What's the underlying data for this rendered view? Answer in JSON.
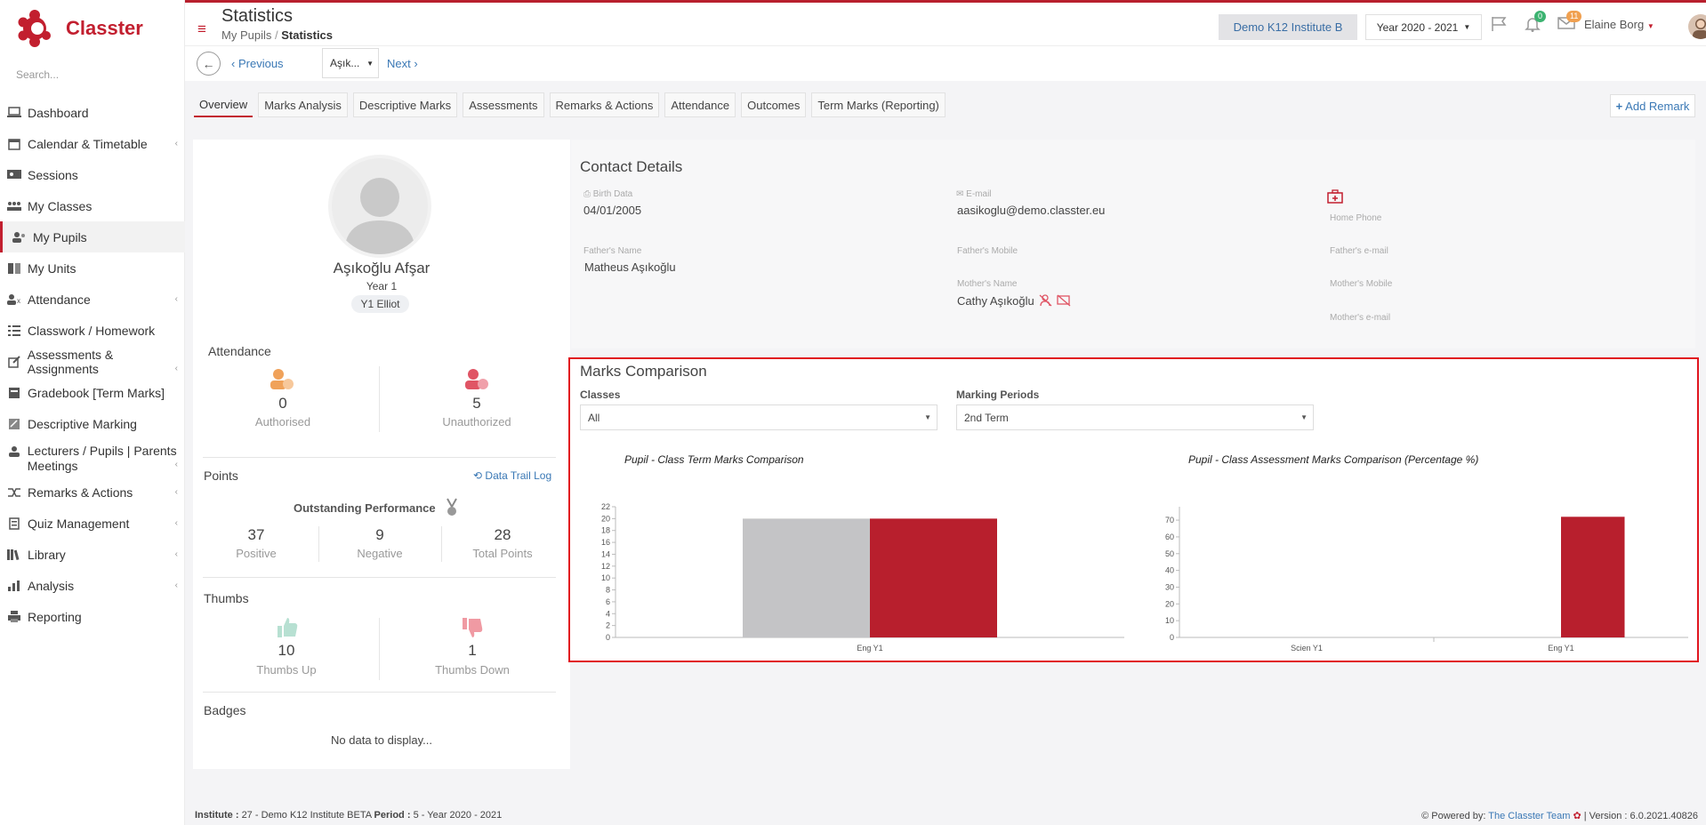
{
  "app": {
    "name": "Classter"
  },
  "sidebar": {
    "search_placeholder": "Search...",
    "items": [
      {
        "label": "Dashboard"
      },
      {
        "label": "Calendar & Timetable"
      },
      {
        "label": "Sessions"
      },
      {
        "label": "My Classes"
      },
      {
        "label": "My Pupils"
      },
      {
        "label": "My Units"
      },
      {
        "label": "Attendance"
      },
      {
        "label": "Classwork / Homework"
      },
      {
        "label": "Assessments & Assignments"
      },
      {
        "label": "Gradebook [Term Marks]"
      },
      {
        "label": "Descriptive Marking"
      },
      {
        "label": "Lecturers / Pupils | Parents Meetings"
      },
      {
        "label": "Remarks & Actions"
      },
      {
        "label": "Quiz Management"
      },
      {
        "label": "Library"
      },
      {
        "label": "Analysis"
      },
      {
        "label": "Reporting"
      }
    ]
  },
  "header": {
    "title": "Statistics",
    "breadcrumb": [
      "My Pupils",
      "Statistics"
    ],
    "institute": "Demo K12 Institute B",
    "year": "Year 2020 - 2021",
    "notifications_count": "0",
    "messages_count": "11",
    "user": "Elaine Borg"
  },
  "subbar": {
    "previous": "Previous",
    "pupil_short": "Aşık...",
    "next": "Next"
  },
  "tabs": [
    "Overview",
    "Marks Analysis",
    "Descriptive Marks",
    "Assessments",
    "Remarks & Actions",
    "Attendance",
    "Outcomes",
    "Term Marks (Reporting)"
  ],
  "add_remark": "Add Remark",
  "pupil": {
    "name": "Aşıkoğlu Afşar",
    "year": "Year 1",
    "class": "Y1 Elliot"
  },
  "attendance": {
    "title": "Attendance",
    "authorised": "0",
    "authorised_label": "Authorised",
    "unauthorized": "5",
    "unauthorized_label": "Unauthorized"
  },
  "points": {
    "title": "Points",
    "data_trail": "Data Trail Log",
    "performance": "Outstanding Performance",
    "positive": "37",
    "positive_label": "Positive",
    "negative": "9",
    "negative_label": "Negative",
    "total": "28",
    "total_label": "Total Points"
  },
  "thumbs": {
    "title": "Thumbs",
    "up": "10",
    "up_label": "Thumbs Up",
    "down": "1",
    "down_label": "Thumbs Down"
  },
  "badges": {
    "title": "Badges",
    "empty": "No data to display..."
  },
  "contact": {
    "title": "Contact Details",
    "birth_label": "Birth Data",
    "birth_value": "04/01/2005",
    "email_label": "E-mail",
    "email_value": "aasikoglu@demo.classter.eu",
    "home_phone_label": "Home Phone",
    "father_name_label": "Father's Name",
    "father_name_value": "Matheus Aşıkoğlu",
    "father_mobile_label": "Father's Mobile",
    "father_email_label": "Father's e-mail",
    "mother_name_label": "Mother's Name",
    "mother_name_value": "Cathy Aşıkoğlu",
    "mother_mobile_label": "Mother's Mobile",
    "mother_email_label": "Mother's e-mail"
  },
  "marks": {
    "title": "Marks Comparison",
    "classes_label": "Classes",
    "classes_value": "All",
    "periods_label": "Marking Periods",
    "periods_value": "2nd Term"
  },
  "chart_data": [
    {
      "type": "bar",
      "title": "Pupil - Class Term Marks Comparison",
      "categories": [
        "Eng Y1"
      ],
      "series": [
        {
          "values": [
            20
          ],
          "color": "#c4c4c6"
        },
        {
          "values": [
            20
          ],
          "color": "#b81f2d"
        }
      ],
      "ylim": [
        0,
        22
      ],
      "yticks": [
        0,
        2,
        4,
        6,
        8,
        10,
        12,
        14,
        16,
        18,
        20,
        22
      ]
    },
    {
      "type": "bar",
      "title": "Pupil - Class Assessment Marks Comparison (Percentage %)",
      "categories": [
        "Scien Y1",
        "Eng Y1"
      ],
      "series": [
        {
          "values": [
            0,
            0
          ],
          "color": "#c4c4c6"
        },
        {
          "values": [
            0,
            72
          ],
          "color": "#b81f2d"
        }
      ],
      "ylim": [
        0,
        78
      ],
      "yticks": [
        0,
        10,
        20,
        30,
        40,
        50,
        60,
        70
      ]
    }
  ],
  "footer": {
    "institute_label": "Institute :",
    "institute_value": "27 - Demo K12 Institute BETA",
    "period_label": "Period :",
    "period_value": "5 - Year 2020 - 2021",
    "powered_label": "Powered by:",
    "powered_value": "The Classter Team",
    "version": "| Version : 6.0.2021.40826"
  },
  "colors": {
    "brand": "#c21f2f",
    "link": "#3a78b5",
    "highlight": "#e1151f"
  }
}
